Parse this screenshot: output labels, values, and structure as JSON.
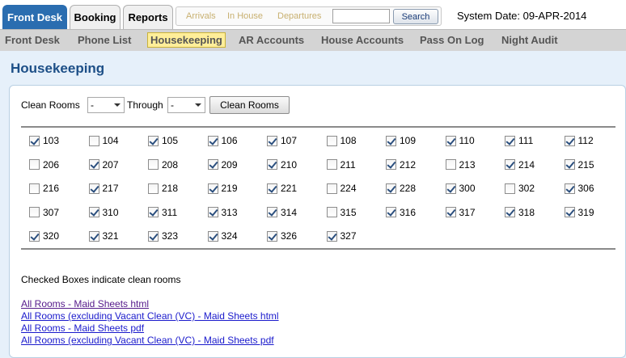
{
  "tabs": [
    "Front Desk",
    "Booking",
    "Reports"
  ],
  "quick_links": [
    "Arrivals",
    "In House",
    "Departures"
  ],
  "search": {
    "value": "",
    "button": "Search"
  },
  "system_date": "System Date: 09-APR-2014",
  "nav": [
    "Front Desk",
    "Phone List",
    "Housekeeping",
    "AR Accounts",
    "House Accounts",
    "Pass On Log",
    "Night Audit"
  ],
  "nav_active": "Housekeeping",
  "page_title": "Housekeeping",
  "controls": {
    "clean_rooms_label": "Clean Rooms",
    "from_value": "-",
    "through_label": "Through",
    "through_value": "-",
    "button": "Clean Rooms"
  },
  "rooms": [
    {
      "number": "103",
      "clean": true
    },
    {
      "number": "104",
      "clean": false
    },
    {
      "number": "105",
      "clean": true
    },
    {
      "number": "106",
      "clean": true
    },
    {
      "number": "107",
      "clean": true
    },
    {
      "number": "108",
      "clean": false
    },
    {
      "number": "109",
      "clean": true
    },
    {
      "number": "110",
      "clean": true
    },
    {
      "number": "111",
      "clean": true
    },
    {
      "number": "112",
      "clean": true
    },
    {
      "number": "206",
      "clean": false
    },
    {
      "number": "207",
      "clean": true
    },
    {
      "number": "208",
      "clean": false
    },
    {
      "number": "209",
      "clean": true
    },
    {
      "number": "210",
      "clean": true
    },
    {
      "number": "211",
      "clean": false
    },
    {
      "number": "212",
      "clean": true
    },
    {
      "number": "213",
      "clean": false
    },
    {
      "number": "214",
      "clean": true
    },
    {
      "number": "215",
      "clean": true
    },
    {
      "number": "216",
      "clean": false
    },
    {
      "number": "217",
      "clean": true
    },
    {
      "number": "218",
      "clean": false
    },
    {
      "number": "219",
      "clean": true
    },
    {
      "number": "221",
      "clean": true
    },
    {
      "number": "224",
      "clean": false
    },
    {
      "number": "228",
      "clean": true
    },
    {
      "number": "300",
      "clean": true
    },
    {
      "number": "302",
      "clean": false
    },
    {
      "number": "306",
      "clean": true
    },
    {
      "number": "307",
      "clean": false
    },
    {
      "number": "310",
      "clean": true
    },
    {
      "number": "311",
      "clean": true
    },
    {
      "number": "313",
      "clean": true
    },
    {
      "number": "314",
      "clean": true
    },
    {
      "number": "315",
      "clean": false
    },
    {
      "number": "316",
      "clean": true
    },
    {
      "number": "317",
      "clean": true
    },
    {
      "number": "318",
      "clean": true
    },
    {
      "number": "319",
      "clean": true
    },
    {
      "number": "320",
      "clean": true
    },
    {
      "number": "321",
      "clean": true
    },
    {
      "number": "323",
      "clean": true
    },
    {
      "number": "324",
      "clean": true
    },
    {
      "number": "326",
      "clean": true
    },
    {
      "number": "327",
      "clean": true
    }
  ],
  "note": "Checked Boxes indicate clean rooms",
  "links": [
    {
      "text": "All Rooms - Maid Sheets html",
      "visited": true
    },
    {
      "text": "All Rooms (excluding Vacant Clean (VC) - Maid Sheets html",
      "visited": false
    },
    {
      "text": "All Rooms - Maid Sheets pdf",
      "visited": false
    },
    {
      "text": "All Rooms (excluding Vacant Clean (VC) - Maid Sheets pdf",
      "visited": false
    }
  ],
  "colors": {
    "accent": "#2a6db0",
    "title": "#1d4f87",
    "active_nav_bg": "#ffee99",
    "link": "#1a1acc",
    "visited_link": "#551a8b"
  }
}
